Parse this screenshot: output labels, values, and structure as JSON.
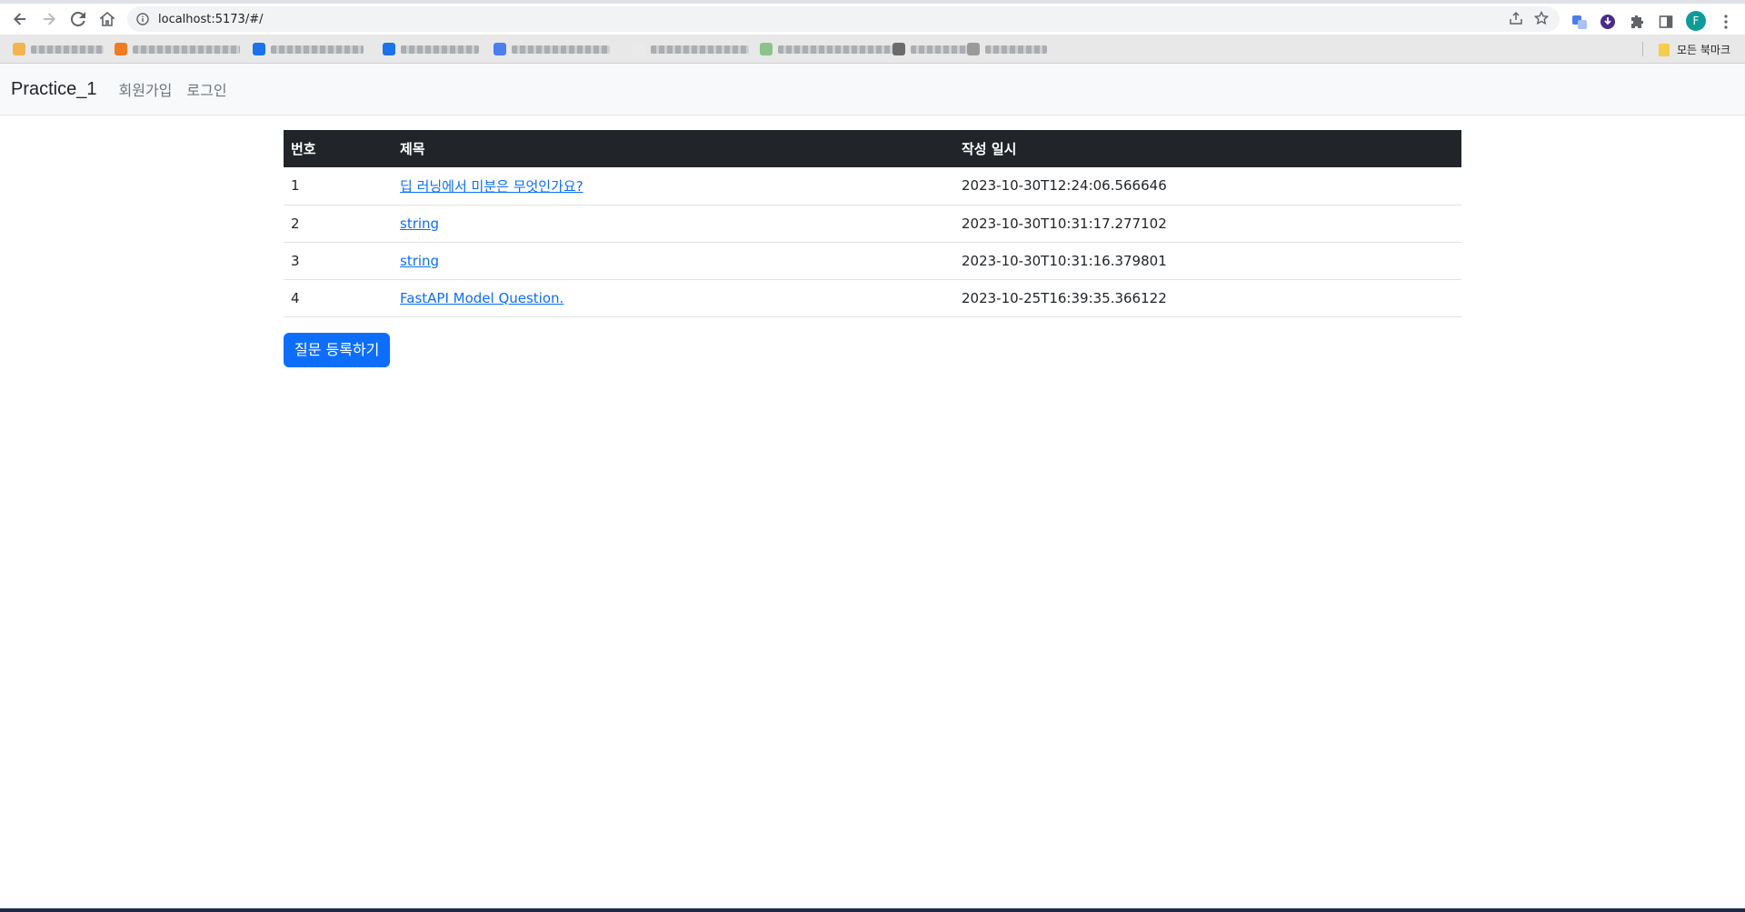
{
  "browser": {
    "url": "localhost:5173/#/",
    "avatar_letter": "F",
    "all_bookmarks_label": "모든 북마크",
    "bookmark_icon_colors": [
      "#f3b44f",
      "#f07c22",
      "#1a73e8",
      "#1a73e8",
      "#4b7ff0",
      "#eaeaea",
      "#8bc48a",
      "#6b6b6b",
      "#9a9a9a"
    ]
  },
  "navbar": {
    "brand": "Practice_1",
    "links": [
      {
        "label": "회원가입"
      },
      {
        "label": "로그인"
      }
    ]
  },
  "table": {
    "headers": [
      "번호",
      "제목",
      "작성 일시"
    ],
    "rows": [
      {
        "num": "1",
        "title": "딥 러닝에서 미분은 무엇인가요?",
        "created": "2023-10-30T12:24:06.566646"
      },
      {
        "num": "2",
        "title": "string",
        "created": "2023-10-30T10:31:17.277102"
      },
      {
        "num": "3",
        "title": "string",
        "created": "2023-10-30T10:31:16.379801"
      },
      {
        "num": "4",
        "title": "FastAPI Model Question.",
        "created": "2023-10-25T16:39:35.366122"
      }
    ]
  },
  "actions": {
    "create_question_label": "질문 등록하기"
  },
  "colors": {
    "primary": "#0d6efd",
    "table_header_bg": "#212529",
    "navbar_bg": "#f8f9fa"
  }
}
